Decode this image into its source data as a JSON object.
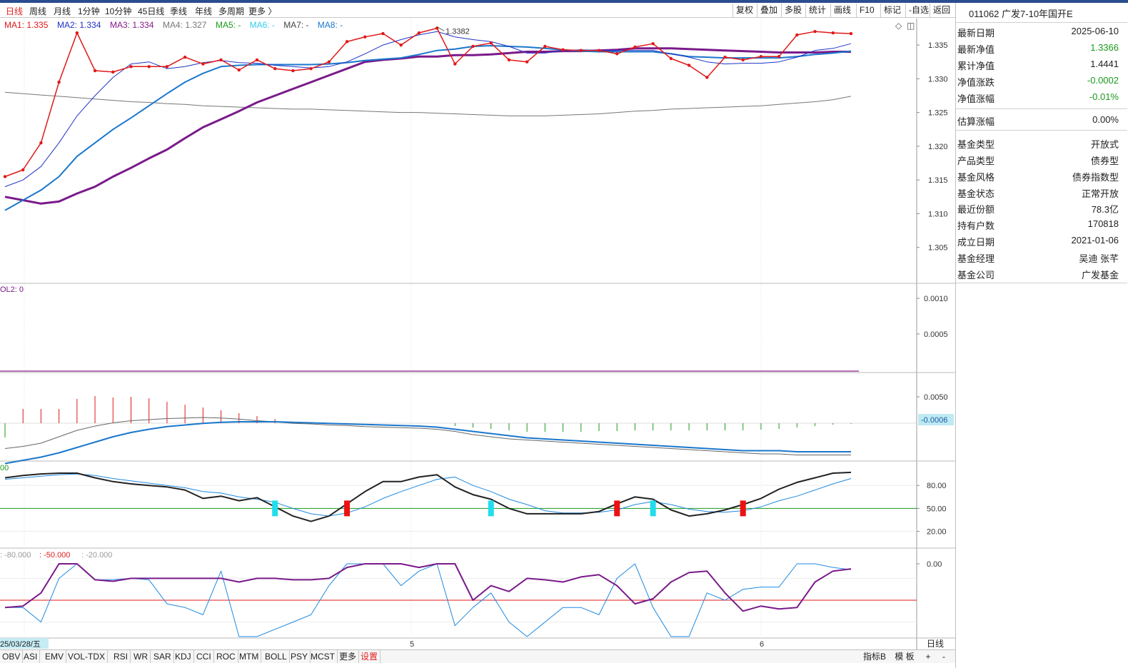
{
  "periods": [
    "日线",
    "周线",
    "月线",
    "1分钟",
    "10分钟",
    "45日线",
    "季线",
    "年线",
    "多周期",
    "更多 〉"
  ],
  "active_period": "日线",
  "tools": [
    "复权",
    "叠加",
    "多股",
    "统计",
    "画线",
    "F10",
    "标记",
    "-自选",
    "返回"
  ],
  "ma_legend": [
    {
      "label": "MA1: 1.335",
      "color": "#e01818"
    },
    {
      "label": "MA2: 1.334",
      "color": "#1f33c6"
    },
    {
      "label": "MA3: 1.334",
      "color": "#8a1a8a"
    },
    {
      "label": "MA4: 1.327",
      "color": "#777777"
    },
    {
      "label": "MA5: -",
      "color": "#1a9a1a"
    },
    {
      "label": "MA6: -",
      "color": "#33ccee"
    },
    {
      "label": "MA7: -",
      "color": "#444444"
    },
    {
      "label": "MA8: -",
      "color": "#1a77cc"
    }
  ],
  "price_axis": [
    "1.335",
    "1.330",
    "1.325",
    "1.320",
    "1.315",
    "1.310",
    "1.305"
  ],
  "peak_label": "1.3382",
  "vol_legend": "OL2: 0",
  "vol_axis": [
    "0.0010",
    "0.0005"
  ],
  "macd_axis": [
    "0.0050"
  ],
  "macd_current": "-0.0006",
  "kdj_legend": "00",
  "kdj_axis": [
    "80.00",
    "50.00",
    "20.00"
  ],
  "wr_legend": [
    {
      "text": ": -80.000",
      "color": "#999999"
    },
    {
      "text": ": -50.000",
      "color": "#e02020"
    },
    {
      "text": ": -20.000",
      "color": "#999999"
    }
  ],
  "wr_axis": [
    "0.00"
  ],
  "date_label": "25/03/28/五",
  "month_labels": [
    "5",
    "6"
  ],
  "period_tag": "日线",
  "indicators": [
    "OBV",
    "ASI",
    "EMV",
    "VOL-TDX",
    "RSI",
    "WR",
    "SAR",
    "KDJ",
    "CCI",
    "ROC",
    "MTM",
    "BOLL",
    "PSY",
    "MCST",
    "更多",
    "设置"
  ],
  "right_tabs": [
    "指标B",
    "模 板",
    "+",
    "-"
  ],
  "fund": {
    "title": "011062 广发7-10年国开E",
    "rows": [
      {
        "label": "最新日期",
        "value": "2025-06-10",
        "color": "#222222"
      },
      {
        "label": "最新净值",
        "value": "1.3366",
        "color": "#1a9a1a"
      },
      {
        "label": "累计净值",
        "value": "1.4441",
        "color": "#222222"
      },
      {
        "label": "净值涨跌",
        "value": "-0.0002",
        "color": "#1a9a1a"
      },
      {
        "label": "净值涨幅",
        "value": "-0.01%",
        "color": "#1a9a1a"
      },
      {
        "label": "估算涨幅",
        "value": "0.00%",
        "color": "#222222"
      },
      {
        "label": "基金类型",
        "value": "开放式",
        "color": "#222222"
      },
      {
        "label": "产品类型",
        "value": "债券型",
        "color": "#222222"
      },
      {
        "label": "基金风格",
        "value": "债券指数型",
        "color": "#222222"
      },
      {
        "label": "基金状态",
        "value": "正常开放",
        "color": "#222222"
      },
      {
        "label": "最近份额",
        "value": "78.3亿",
        "color": "#222222"
      },
      {
        "label": "持有户数",
        "value": "170818",
        "color": "#222222"
      },
      {
        "label": "成立日期",
        "value": "2021-01-06",
        "color": "#222222"
      },
      {
        "label": "基金经理",
        "value": "吴迪 张芊",
        "color": "#222222"
      },
      {
        "label": "基金公司",
        "value": "广发基金",
        "color": "#222222"
      }
    ]
  },
  "chart_data": {
    "type": "line",
    "x_count": 48,
    "price_ylim": [
      1.3,
      1.3385
    ],
    "ma1": [
      1.3155,
      1.3165,
      1.3205,
      1.3295,
      1.3368,
      1.3312,
      1.331,
      1.3318,
      1.3318,
      1.3318,
      1.3332,
      1.3322,
      1.3328,
      1.3313,
      1.3328,
      1.3315,
      1.3312,
      1.3315,
      1.3325,
      1.3355,
      1.3362,
      1.3367,
      1.335,
      1.3368,
      1.3375,
      1.3322,
      1.3348,
      1.3353,
      1.3328,
      1.3325,
      1.3348,
      1.3343,
      1.3342,
      1.3342,
      1.3337,
      1.3347,
      1.3352,
      1.333,
      1.332,
      1.3302,
      1.3332,
      1.3328,
      1.3333,
      1.3333,
      1.3365,
      1.337,
      1.3368,
      1.3367
    ],
    "ma2": [
      1.314,
      1.315,
      1.317,
      1.3205,
      1.3245,
      1.3275,
      1.3302,
      1.3322,
      1.3325,
      1.3315,
      1.3318,
      1.3324,
      1.3327,
      1.3324,
      1.3323,
      1.332,
      1.3318,
      1.3316,
      1.3318,
      1.3325,
      1.3337,
      1.335,
      1.3358,
      1.3365,
      1.337,
      1.3362,
      1.3358,
      1.3355,
      1.3348,
      1.3338,
      1.3338,
      1.3342,
      1.3343,
      1.3342,
      1.3342,
      1.3342,
      1.3342,
      1.3337,
      1.3332,
      1.3325,
      1.3322,
      1.3323,
      1.3323,
      1.3325,
      1.3332,
      1.3342,
      1.3345,
      1.3352
    ],
    "ma3": [
      1.3125,
      1.312,
      1.3115,
      1.3118,
      1.313,
      1.314,
      1.3155,
      1.3168,
      1.3182,
      1.3195,
      1.3212,
      1.3228,
      1.324,
      1.3252,
      1.3265,
      1.3275,
      1.3285,
      1.3295,
      1.3305,
      1.3315,
      1.3325,
      1.3328,
      1.333,
      1.3333,
      1.3333,
      1.3335,
      1.3335,
      1.3336,
      1.3338,
      1.334,
      1.334,
      1.3341,
      1.3341,
      1.3342,
      1.3343,
      1.3345,
      1.3345,
      1.3345,
      1.3344,
      1.3343,
      1.3342,
      1.3341,
      1.334,
      1.3339,
      1.3339,
      1.3339,
      1.334,
      1.334
    ],
    "ma4": [
      1.328,
      1.3278,
      1.3276,
      1.3274,
      1.3272,
      1.327,
      1.3268,
      1.3266,
      1.3265,
      1.3263,
      1.3262,
      1.326,
      1.3259,
      1.3258,
      1.3257,
      1.3256,
      1.3255,
      1.3255,
      1.3254,
      1.3253,
      1.3252,
      1.3251,
      1.325,
      1.325,
      1.3249,
      1.3248,
      1.3247,
      1.3246,
      1.3245,
      1.3245,
      1.3245,
      1.3246,
      1.3247,
      1.3248,
      1.325,
      1.3252,
      1.3253,
      1.3255,
      1.3256,
      1.3257,
      1.3258,
      1.3259,
      1.326,
      1.3262,
      1.3264,
      1.3266,
      1.3269,
      1.3274
    ],
    "ma8": [
      1.3105,
      1.312,
      1.3135,
      1.3155,
      1.3185,
      1.3205,
      1.3225,
      1.3242,
      1.326,
      1.3278,
      1.3295,
      1.3308,
      1.3318,
      1.332,
      1.3321,
      1.3321,
      1.3321,
      1.3321,
      1.3322,
      1.3324,
      1.3327,
      1.3329,
      1.3331,
      1.3336,
      1.3342,
      1.3344,
      1.3348,
      1.3349,
      1.3348,
      1.3347,
      1.3345,
      1.3343,
      1.3341,
      1.334,
      1.334,
      1.334,
      1.334,
      1.3337,
      1.3333,
      1.3332,
      1.3331,
      1.3331,
      1.3331,
      1.3331,
      1.3333,
      1.3336,
      1.3338,
      1.3341
    ],
    "kdj_ylim": [
      0,
      110
    ],
    "kdj_k": [
      90,
      93,
      95,
      96,
      96,
      90,
      85,
      82,
      80,
      78,
      74,
      63,
      66,
      60,
      64,
      52,
      40,
      33,
      40,
      56,
      72,
      85,
      85,
      91,
      94,
      78,
      68,
      62,
      50,
      43,
      43,
      43,
      43,
      46,
      56,
      65,
      62,
      48,
      40,
      43,
      48,
      55,
      63,
      75,
      84,
      90,
      96,
      97
    ],
    "kdj_d": [
      88,
      90,
      92,
      94,
      95,
      93,
      89,
      86,
      83,
      80,
      77,
      72,
      70,
      65,
      62,
      58,
      50,
      43,
      40,
      44,
      52,
      63,
      72,
      80,
      88,
      91,
      80,
      72,
      62,
      55,
      47,
      44,
      44,
      45,
      48,
      55,
      59,
      55,
      49,
      46,
      45,
      47,
      52,
      60,
      66,
      74,
      82,
      89
    ],
    "kdj_signals": [
      {
        "i": 15,
        "c": "cyan"
      },
      {
        "i": 19,
        "c": "red"
      },
      {
        "i": 27,
        "c": "cyan"
      },
      {
        "i": 34,
        "c": "red"
      },
      {
        "i": 36,
        "c": "cyan"
      },
      {
        "i": 41,
        "c": "red"
      }
    ],
    "wr1": [
      -60,
      -58,
      -40,
      0,
      0,
      -22,
      -24,
      -20,
      -20,
      -20,
      -20,
      -20,
      -20,
      -25,
      -20,
      -20,
      -22,
      -22,
      -20,
      -5,
      0,
      0,
      0,
      -5,
      0,
      0,
      -50,
      -30,
      -38,
      -20,
      -22,
      -25,
      -18,
      -15,
      -30,
      -55,
      -48,
      -25,
      -12,
      -10,
      -40,
      -65,
      -58,
      -62,
      -60,
      -25,
      -10,
      -7
    ],
    "wr2": [
      -60,
      -60,
      -80,
      -20,
      0,
      -22,
      -22,
      -20,
      -22,
      -55,
      -60,
      -70,
      -10,
      -100,
      -100,
      -90,
      -80,
      -70,
      -30,
      0,
      0,
      0,
      -30,
      -10,
      0,
      -85,
      -60,
      -40,
      -80,
      -100,
      -80,
      -60,
      -60,
      -70,
      -20,
      0,
      -60,
      -100,
      -100,
      -40,
      -50,
      -35,
      -32,
      -32,
      0,
      0,
      -5,
      -8
    ]
  }
}
